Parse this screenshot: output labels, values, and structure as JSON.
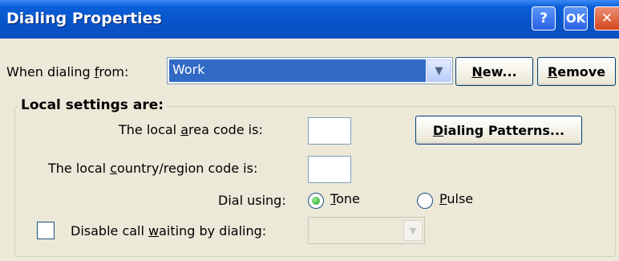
{
  "window": {
    "title": "Dialing Properties",
    "help_label": "?",
    "ok_label": "OK",
    "close_label": "✕"
  },
  "dialing_from": {
    "label_pre": "When dialing ",
    "label_key": "f",
    "label_post": "rom:",
    "value": "Work",
    "arrow": "▼"
  },
  "buttons": {
    "new": {
      "pre": "",
      "key": "N",
      "post": "ew..."
    },
    "remove": {
      "pre": "",
      "key": "R",
      "post": "emove"
    },
    "dialing_patterns": {
      "pre": "",
      "key": "D",
      "post": "ialing Patterns..."
    }
  },
  "local_settings": {
    "group_title": "Local settings are:",
    "area_code": {
      "pre": "The local ",
      "key": "a",
      "post": "rea code is:",
      "value": ""
    },
    "country_code": {
      "pre": "The local ",
      "key": "c",
      "post": "ountry/region code is:",
      "value": ""
    },
    "dial_using_label": "Dial using:",
    "tone": {
      "pre": "",
      "key": "T",
      "post": "one",
      "selected": true
    },
    "pulse": {
      "pre": "",
      "key": "P",
      "post": "ulse",
      "selected": false
    },
    "call_waiting": {
      "pre": "Disable call ",
      "key": "w",
      "post": "aiting by dialing:",
      "checked": false,
      "value": ""
    }
  }
}
